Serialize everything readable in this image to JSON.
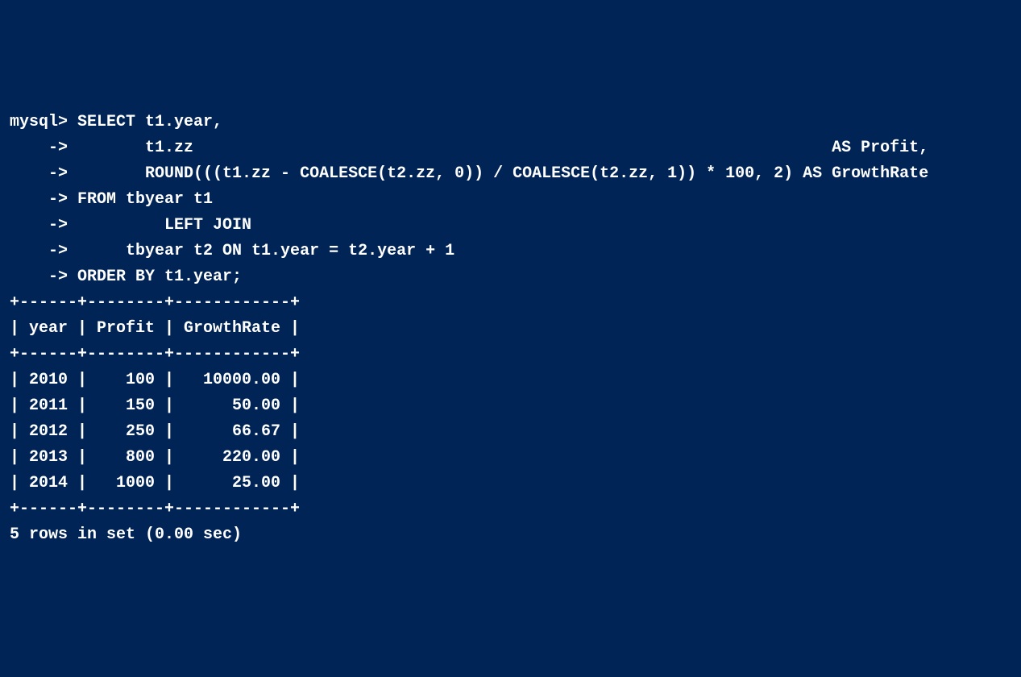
{
  "prompt": "mysql>",
  "continuation": "    ->",
  "query": {
    "line1": " SELECT t1.year,",
    "line2": "        t1.zz                                                                  AS Profit,",
    "line3": "        ROUND(((t1.zz - COALESCE(t2.zz, 0)) / COALESCE(t2.zz, 1)) * 100, 2) AS GrowthRate",
    "line4": " FROM tbyear t1",
    "line5": "          LEFT JOIN",
    "line6": "      tbyear t2 ON t1.year = t2.year + 1",
    "line7": " ORDER BY t1.year;"
  },
  "table": {
    "border": "+------+--------+------------+",
    "header": "| year | Profit | GrowthRate |",
    "rows": [
      "| 2010 |    100 |   10000.00 |",
      "| 2011 |    150 |      50.00 |",
      "| 2012 |    250 |      66.67 |",
      "| 2013 |    800 |     220.00 |",
      "| 2014 |   1000 |      25.00 |"
    ]
  },
  "status": "5 rows in set (0.00 sec)",
  "chart_data": {
    "type": "table",
    "columns": [
      "year",
      "Profit",
      "GrowthRate"
    ],
    "data": [
      {
        "year": 2010,
        "Profit": 100,
        "GrowthRate": 10000.0
      },
      {
        "year": 2011,
        "Profit": 150,
        "GrowthRate": 50.0
      },
      {
        "year": 2012,
        "Profit": 250,
        "GrowthRate": 66.67
      },
      {
        "year": 2013,
        "Profit": 800,
        "GrowthRate": 220.0
      },
      {
        "year": 2014,
        "Profit": 1000,
        "GrowthRate": 25.0
      }
    ]
  }
}
